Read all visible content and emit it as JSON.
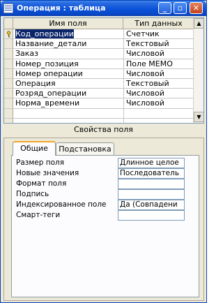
{
  "window": {
    "title": "Операция : таблица"
  },
  "grid": {
    "headers": {
      "field_name": "Имя поля",
      "data_type": "Тип данных"
    },
    "rows": [
      {
        "name": "Код_операции",
        "type": "Счетчик"
      },
      {
        "name": "Название_детали",
        "type": "Текстовый"
      },
      {
        "name": "Заказ",
        "type": "Числовой"
      },
      {
        "name": "Номер_позиция",
        "type": "Поле MEMO"
      },
      {
        "name": "Номер операции",
        "type": "Числовой"
      },
      {
        "name": "Операция",
        "type": "Текстовый"
      },
      {
        "name": "Розряд_операции",
        "type": "Числовой"
      },
      {
        "name": "Норма_времени",
        "type": "Числовой"
      },
      {
        "name": "",
        "type": ""
      },
      {
        "name": "",
        "type": ""
      }
    ]
  },
  "section_label": "Свойства поля",
  "tabs": [
    {
      "label": "Общие"
    },
    {
      "label": "Подстановка"
    }
  ],
  "properties": [
    {
      "label": "Размер поля",
      "value": "Длинное целое"
    },
    {
      "label": "Новые значения",
      "value": "Последователь"
    },
    {
      "label": "Формат поля",
      "value": ""
    },
    {
      "label": "Подпись",
      "value": ""
    },
    {
      "label": "Индексированное поле",
      "value": "Да (Совпадени"
    },
    {
      "label": "Смарт-теги",
      "value": ""
    }
  ]
}
